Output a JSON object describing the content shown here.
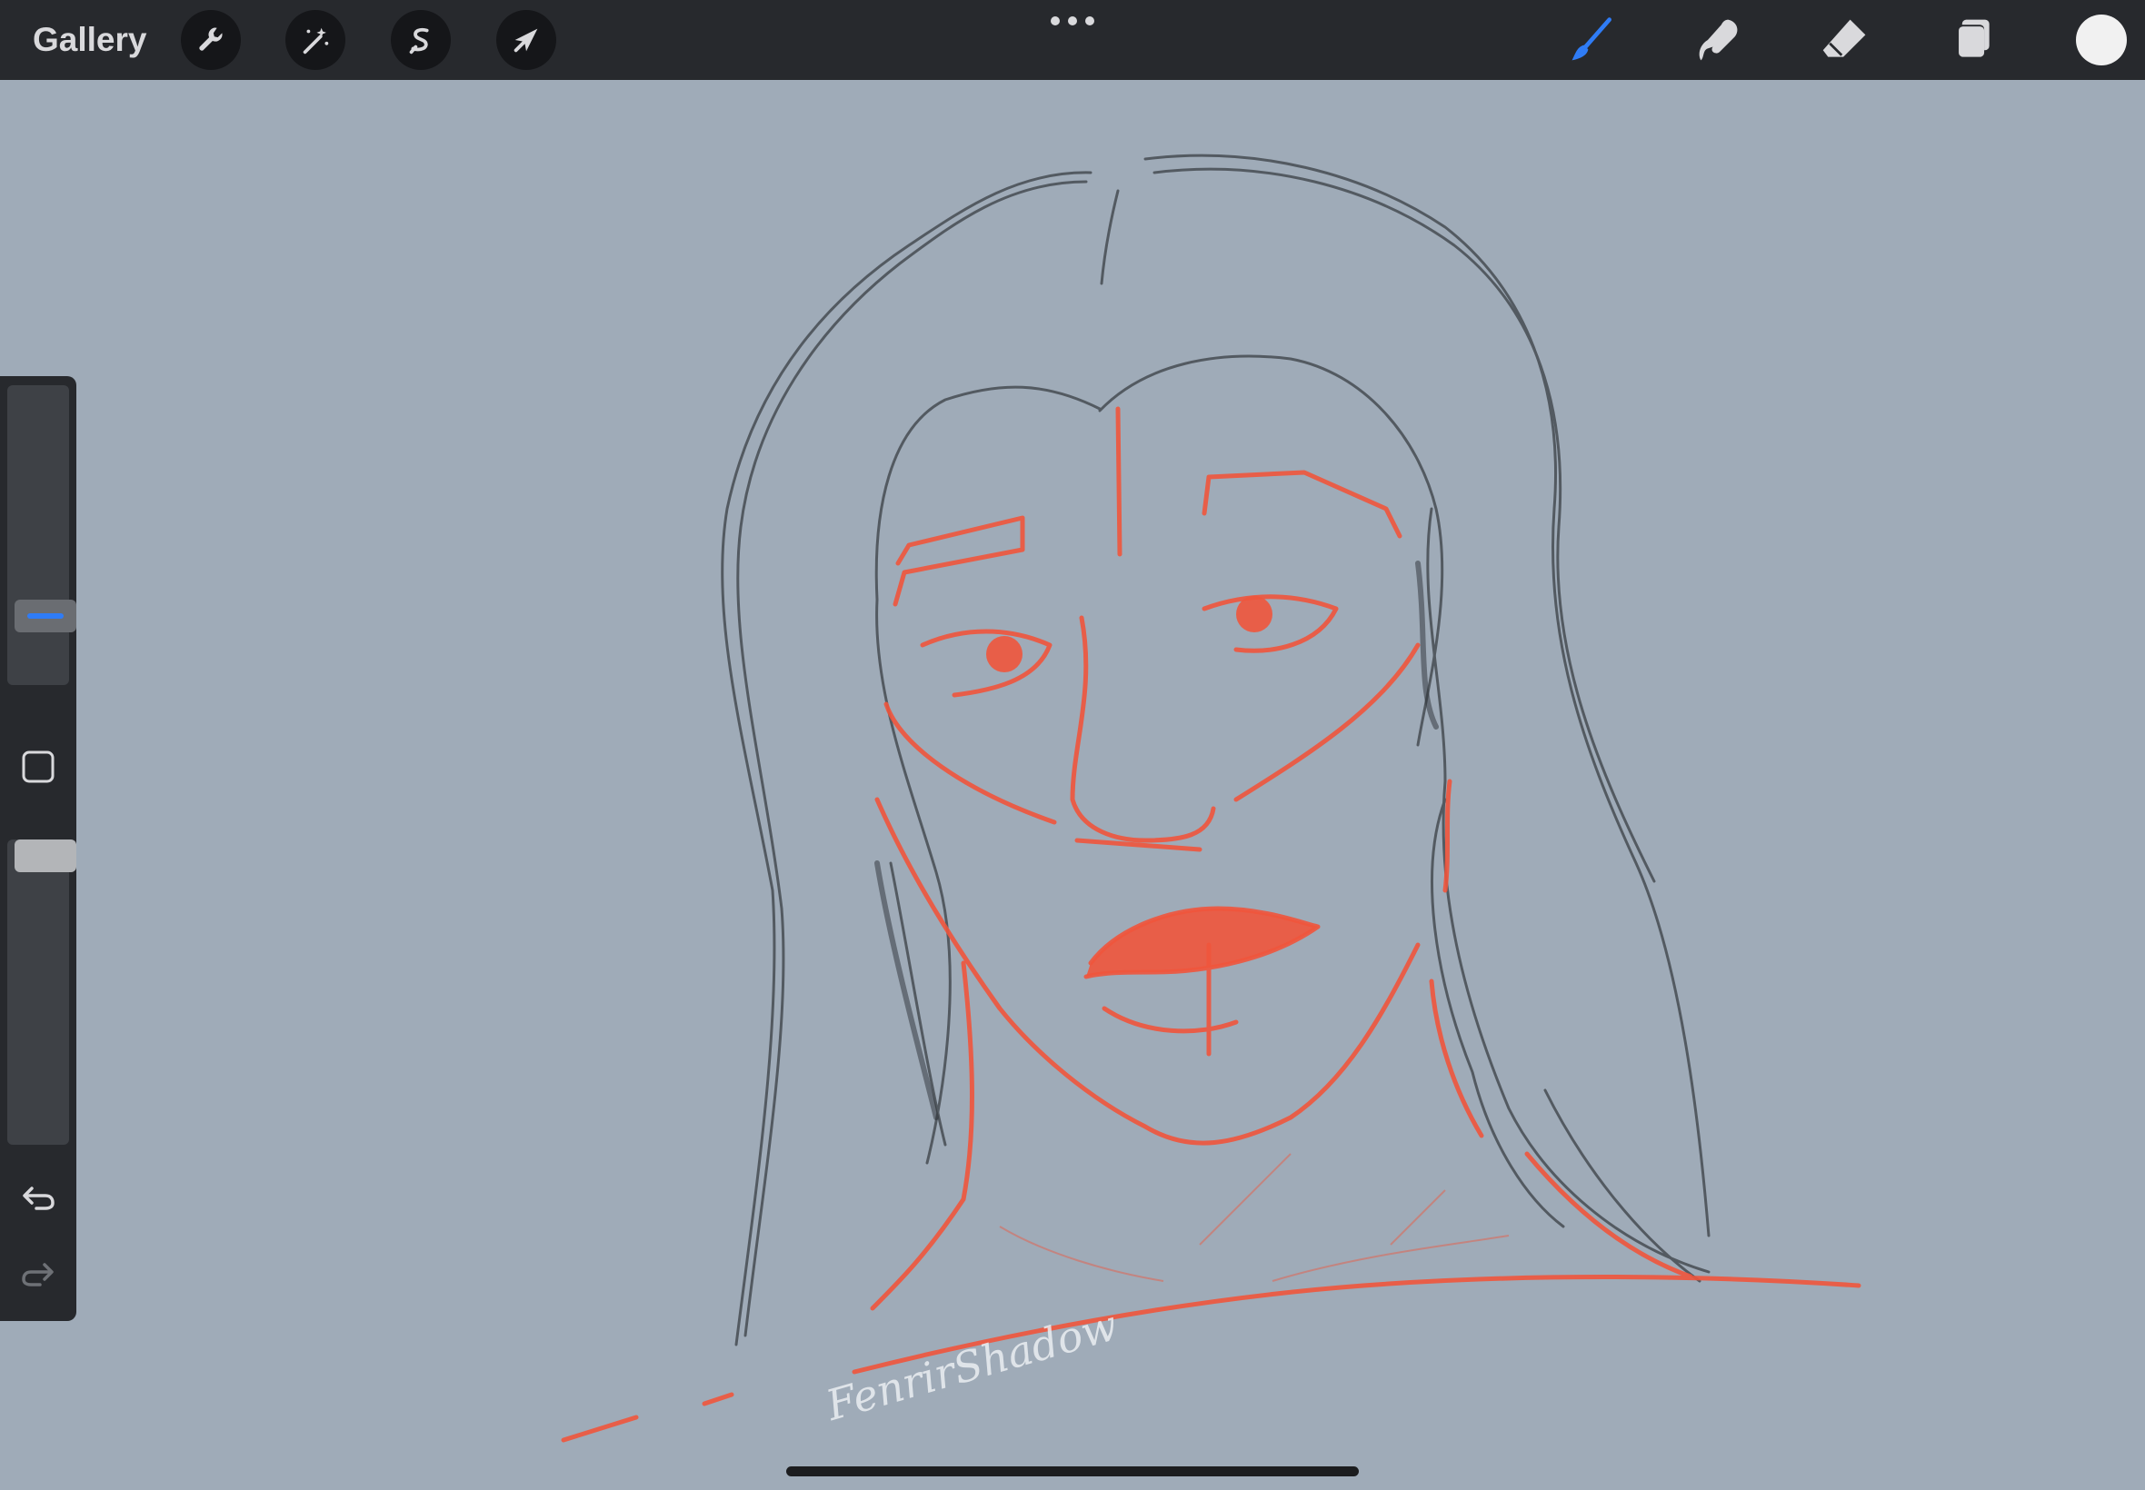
{
  "topbar": {
    "gallery_label": "Gallery",
    "left_tools": [
      {
        "name": "actions",
        "icon": "wrench-icon"
      },
      {
        "name": "adjustments",
        "icon": "magic-wand-icon"
      },
      {
        "name": "selection",
        "icon": "selection-s-icon"
      },
      {
        "name": "transform",
        "icon": "arrow-cursor-icon"
      }
    ],
    "more_icon": "ellipsis-icon",
    "right_tools": [
      {
        "name": "brush",
        "icon": "brush-icon",
        "active": true
      },
      {
        "name": "smudge",
        "icon": "smudge-finger-icon",
        "active": false
      },
      {
        "name": "eraser",
        "icon": "eraser-icon",
        "active": false
      },
      {
        "name": "layers",
        "icon": "layers-icon",
        "active": false
      }
    ],
    "current_color": "#f1f1f1"
  },
  "sidebar": {
    "brush_size_level": 0.72,
    "opacity_level": 0.95,
    "modify_icon": "square-modify-icon",
    "undo_icon": "undo-arrow-icon",
    "redo_icon": "redo-arrow-icon"
  },
  "canvas": {
    "background_color": "#9fabb8",
    "sketch_color": "#3a3f45",
    "guide_color": "#f0553c",
    "signature": "FenrirShadow"
  },
  "colors": {
    "toolbar_bg": "#27292d",
    "accent_blue": "#2f7cf6"
  }
}
